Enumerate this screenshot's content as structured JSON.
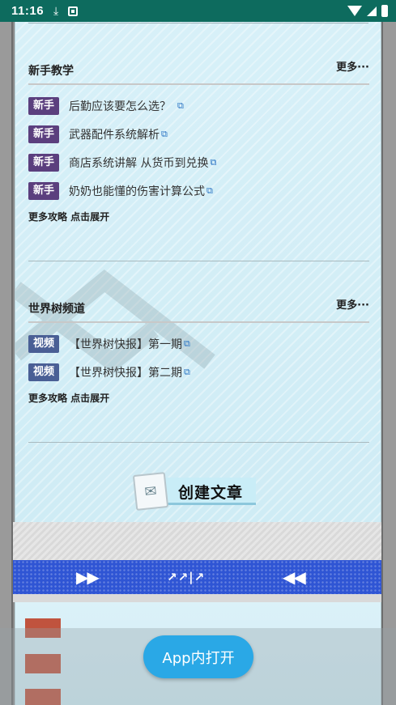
{
  "status_bar": {
    "time": "11:16"
  },
  "sections": [
    {
      "title": "新手教学",
      "more": "更多···",
      "items": [
        {
          "tag": "新手",
          "text": "后勤应该要怎么选？",
          "tag_color": "#5b3f7e"
        },
        {
          "tag": "新手",
          "text": "武器配件系统解析",
          "tag_color": "#5b3f7e"
        },
        {
          "tag": "新手",
          "text": "商店系统讲解 从货币到兑换",
          "tag_color": "#5b3f7e"
        },
        {
          "tag": "新手",
          "text": "奶奶也能懂的伤害计算公式",
          "tag_color": "#5b3f7e"
        }
      ],
      "expand": "更多攻略 点击展开"
    },
    {
      "title": "世界树频道",
      "more": "更多···",
      "items": [
        {
          "tag": "视频",
          "text": "【世界树快报】第一期",
          "tag_color": "#4a5f95"
        },
        {
          "tag": "视频",
          "text": "【世界树快报】第二期",
          "tag_color": "#4a5f95"
        }
      ],
      "expand": "更多攻略 点击展开"
    }
  ],
  "create_button": {
    "label": "创建文章",
    "icon": "document-icon"
  },
  "banner": {
    "arrows_right": "▶▶",
    "center": "↗↗|↗",
    "arrows_left": "◀◀",
    "color": "#2f55d4"
  },
  "open_in_app": {
    "label": "App内打开",
    "color": "#2aa8e6"
  }
}
